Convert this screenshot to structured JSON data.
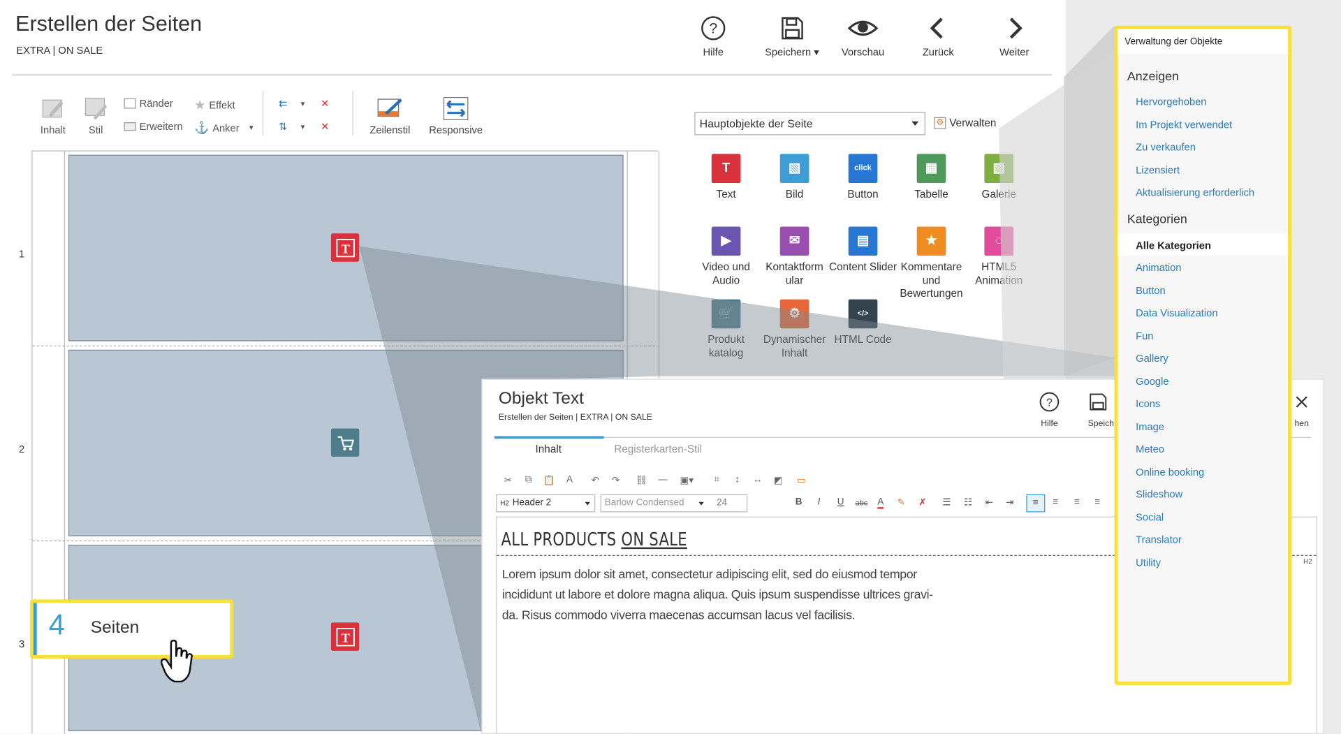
{
  "header": {
    "title": "Erstellen der Seiten",
    "subtitle": "EXTRA | ON SALE",
    "buttons": [
      {
        "label": "Hilfe",
        "icon": "help-icon"
      },
      {
        "label": "Speichern ▾",
        "icon": "save-icon"
      },
      {
        "label": "Vorschau",
        "icon": "eye-icon"
      },
      {
        "label": "Zurück",
        "icon": "chevron-left-icon"
      },
      {
        "label": "Weiter",
        "icon": "chevron-right-icon"
      }
    ]
  },
  "ribbon": {
    "inhalt": "Inhalt",
    "stil": "Stil",
    "raender": "Ränder",
    "erweitern": "Erweitern",
    "effekt": "Effekt",
    "anker": "Anker",
    "zeilenstil": "Zeilenstil",
    "responsive": "Responsive"
  },
  "canvas": {
    "rows": [
      "1",
      "2",
      "3"
    ]
  },
  "palette": {
    "select_value": "Hauptobjekte der Seite",
    "manage_label": "Verwalten",
    "items": [
      {
        "label": "Text",
        "color": "#d9323c"
      },
      {
        "label": "Bild",
        "color": "#3e9dd6"
      },
      {
        "label": "Button",
        "color": "#2677d4"
      },
      {
        "label": "Tabelle",
        "color": "#4d9a5c"
      },
      {
        "label": "Galerie",
        "color": "#7dae3f"
      },
      {
        "label": "Video und Audio",
        "color": "#6a55b0"
      },
      {
        "label": "Kontaktform ular",
        "color": "#9a4fb0"
      },
      {
        "label": "Content Slider",
        "color": "#2677d4"
      },
      {
        "label": "Kommentare und Bewertungen",
        "color": "#f08d22"
      },
      {
        "label": "HTML5 Animation",
        "color": "#e04b9a"
      },
      {
        "label": "Produkt katalog",
        "color": "#4f7d8c"
      },
      {
        "label": "Dynamischer Inhalt",
        "color": "#e8673a"
      },
      {
        "label": "HTML Code",
        "color": "#33444f"
      }
    ]
  },
  "dialog": {
    "title": "Objekt Text",
    "subtitle": "Erstellen der Seiten | EXTRA | ON SALE",
    "help_label": "Hilfe",
    "save_label": "Speich",
    "close_label": "hen",
    "tabs": [
      "Inhalt",
      "Registerkarten-Stil"
    ],
    "heading_select": "Header 2",
    "heading_badge": "H2",
    "font_select": "Barlow Condensed",
    "size_select": "24",
    "editor_heading_a": "ALL PRODUCTS ",
    "editor_heading_b": "ON SALE",
    "editor_tag": "H2",
    "editor_paragraph": "Lorem ipsum dolor sit amet, consectetur adipiscing elit, sed do eiusmod tempor incididunt ut labore et dolore magna aliqua. Quis ipsum suspendisse ultrices gravi-da. Risus commodo viverra maecenas accumsan lacus vel facilisis."
  },
  "panel": {
    "title": "Verwaltung der Objekte",
    "anzeigen_heading": "Anzeigen",
    "anzeigen": [
      "Hervorgehoben",
      "Im Projekt verwendet",
      "Zu verkaufen",
      "Lizensiert",
      "Aktualisierung erforderlich"
    ],
    "kategorien_heading": "Kategorien",
    "active": "Alle Kategorien",
    "kategorien": [
      "Animation",
      "Button",
      "Data Visualization",
      "Fun",
      "Gallery",
      "Google",
      "Icons",
      "Image",
      "Meteo",
      "Online booking",
      "Slideshow",
      "Social",
      "Translator",
      "Utility"
    ]
  },
  "callout": {
    "number": "4",
    "label": "Seiten"
  },
  "colors": {
    "accent_yellow": "#f5e03c",
    "link_blue": "#2a7ab0",
    "text_red": "#d9323c"
  }
}
